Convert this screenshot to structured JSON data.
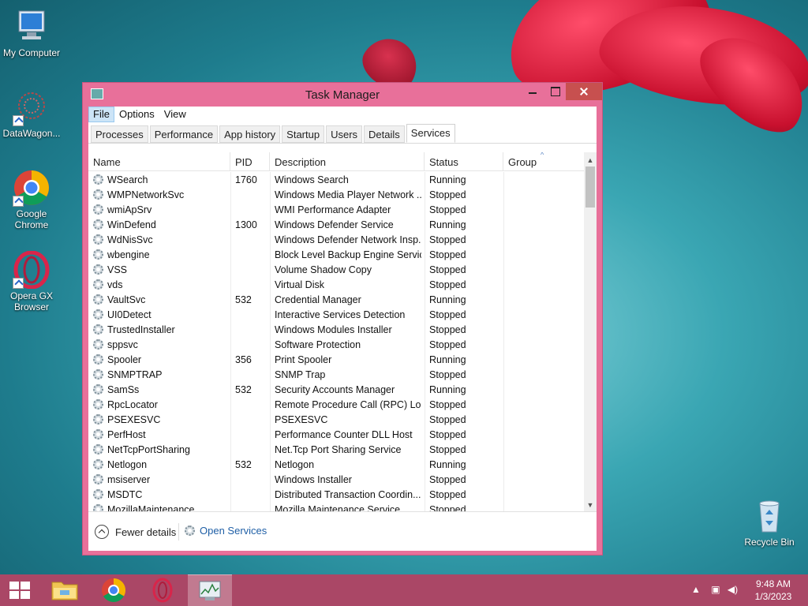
{
  "desktop": {
    "icons": [
      {
        "label": "My Computer"
      },
      {
        "label": "DataWagon..."
      },
      {
        "label": "Google Chrome"
      },
      {
        "label": "Opera GX Browser"
      },
      {
        "label": "Recycle Bin"
      }
    ]
  },
  "window": {
    "title": "Task Manager",
    "menu": [
      "File",
      "Options",
      "View"
    ],
    "tabs": [
      "Processes",
      "Performance",
      "App history",
      "Startup",
      "Users",
      "Details",
      "Services"
    ],
    "selected_tab": "Services",
    "columns": [
      "Name",
      "PID",
      "Description",
      "Status",
      "Group"
    ],
    "rows": [
      {
        "name": "WSearch",
        "pid": "1760",
        "desc": "Windows Search",
        "status": "Running"
      },
      {
        "name": "WMPNetworkSvc",
        "pid": "",
        "desc": "Windows Media Player Network ...",
        "status": "Stopped"
      },
      {
        "name": "wmiApSrv",
        "pid": "",
        "desc": "WMI Performance Adapter",
        "status": "Stopped"
      },
      {
        "name": "WinDefend",
        "pid": "1300",
        "desc": "Windows Defender Service",
        "status": "Running"
      },
      {
        "name": "WdNisSvc",
        "pid": "",
        "desc": "Windows Defender Network Insp...",
        "status": "Stopped"
      },
      {
        "name": "wbengine",
        "pid": "",
        "desc": "Block Level Backup Engine Service",
        "status": "Stopped"
      },
      {
        "name": "VSS",
        "pid": "",
        "desc": "Volume Shadow Copy",
        "status": "Stopped"
      },
      {
        "name": "vds",
        "pid": "",
        "desc": "Virtual Disk",
        "status": "Stopped"
      },
      {
        "name": "VaultSvc",
        "pid": "532",
        "desc": "Credential Manager",
        "status": "Running"
      },
      {
        "name": "UI0Detect",
        "pid": "",
        "desc": "Interactive Services Detection",
        "status": "Stopped"
      },
      {
        "name": "TrustedInstaller",
        "pid": "",
        "desc": "Windows Modules Installer",
        "status": "Stopped"
      },
      {
        "name": "sppsvc",
        "pid": "",
        "desc": "Software Protection",
        "status": "Stopped"
      },
      {
        "name": "Spooler",
        "pid": "356",
        "desc": "Print Spooler",
        "status": "Running"
      },
      {
        "name": "SNMPTRAP",
        "pid": "",
        "desc": "SNMP Trap",
        "status": "Stopped"
      },
      {
        "name": "SamSs",
        "pid": "532",
        "desc": "Security Accounts Manager",
        "status": "Running"
      },
      {
        "name": "RpcLocator",
        "pid": "",
        "desc": "Remote Procedure Call (RPC) Lo...",
        "status": "Stopped"
      },
      {
        "name": "PSEXESVC",
        "pid": "",
        "desc": "PSEXESVC",
        "status": "Stopped"
      },
      {
        "name": "PerfHost",
        "pid": "",
        "desc": "Performance Counter DLL Host",
        "status": "Stopped"
      },
      {
        "name": "NetTcpPortSharing",
        "pid": "",
        "desc": "Net.Tcp Port Sharing Service",
        "status": "Stopped"
      },
      {
        "name": "Netlogon",
        "pid": "532",
        "desc": "Netlogon",
        "status": "Running"
      },
      {
        "name": "msiserver",
        "pid": "",
        "desc": "Windows Installer",
        "status": "Stopped"
      },
      {
        "name": "MSDTC",
        "pid": "",
        "desc": "Distributed Transaction Coordin...",
        "status": "Stopped"
      },
      {
        "name": "MozillaMaintenance",
        "pid": "",
        "desc": "Mozilla Maintenance Service",
        "status": "Stopped"
      }
    ],
    "footer": {
      "fewer_details": "Fewer details",
      "open_services": "Open Services"
    }
  },
  "taskbar": {
    "time": "9:48 AM",
    "date": "1/3/2023"
  },
  "colors": {
    "window_frame": "#e8709a",
    "taskbar": "#aa4766",
    "close_button": "#c7504f",
    "link": "#1f5fa6"
  }
}
